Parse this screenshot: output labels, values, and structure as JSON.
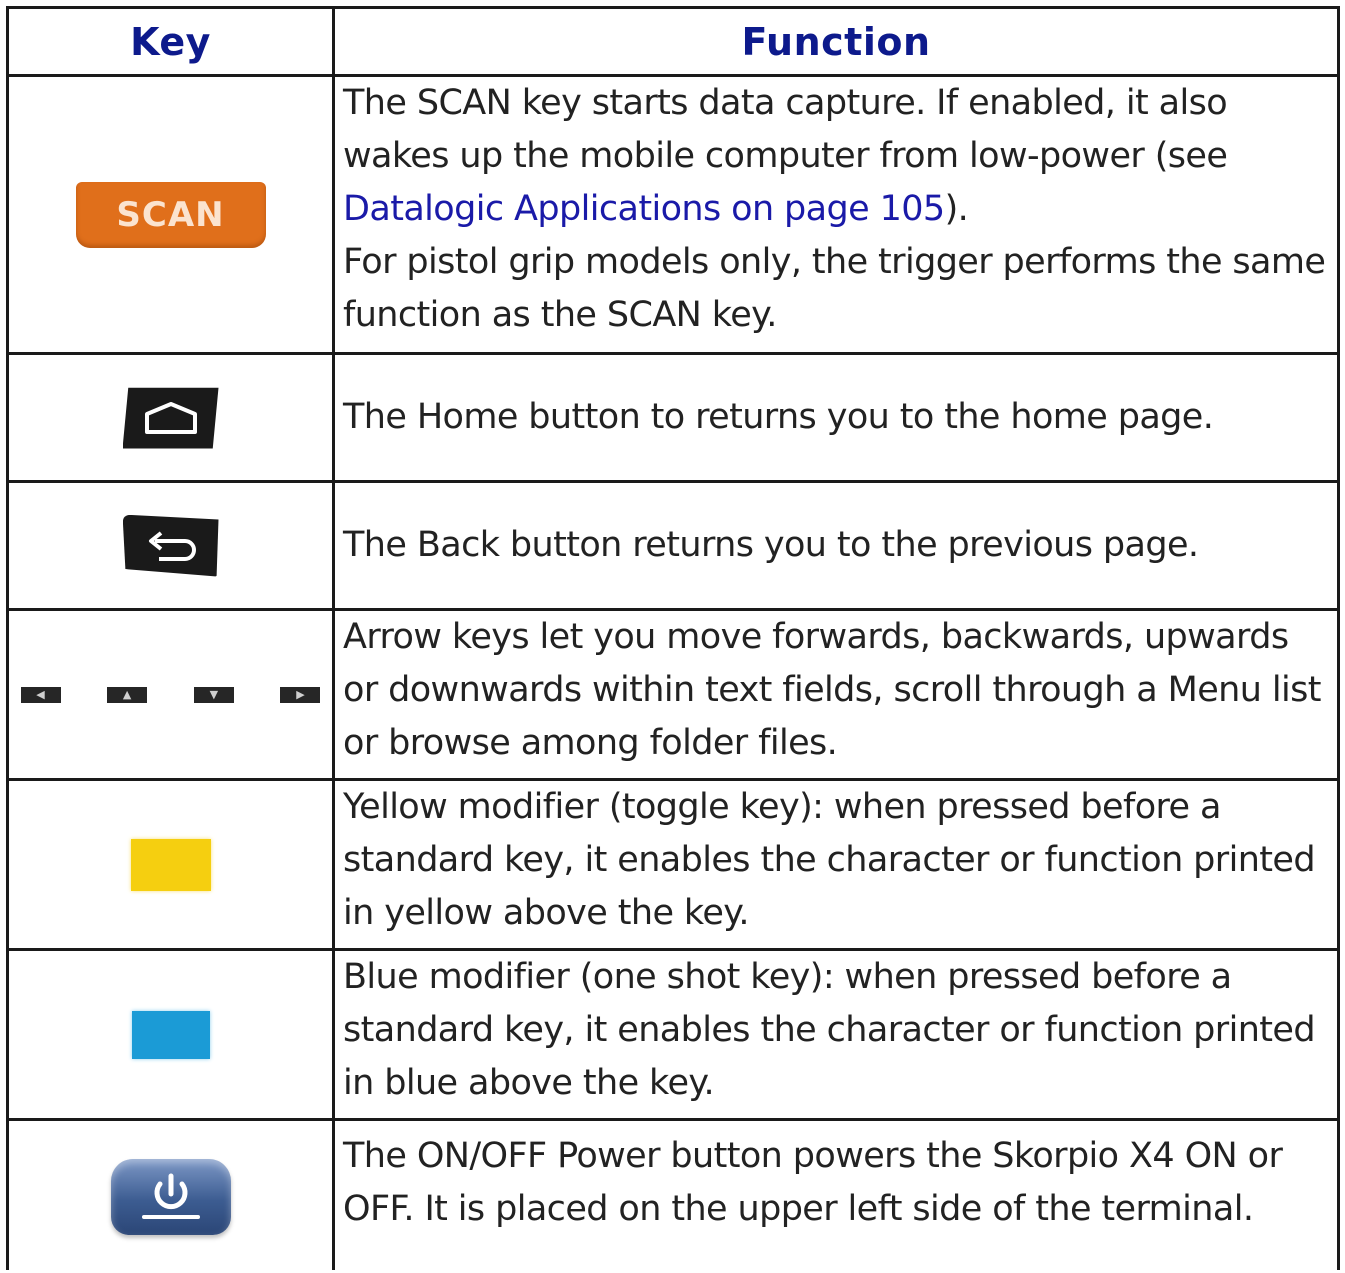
{
  "header": {
    "key": "Key",
    "function": "Function"
  },
  "rows": [
    {
      "key_label": "SCAN",
      "icon": "scan-key",
      "function_parts": {
        "p1_before": "The SCAN key starts data capture. If enabled, it also wakes up the mobile computer from low-power (see ",
        "p1_link": "Datalogic Applications on page 105",
        "p1_after": ").",
        "p2": "For pistol grip models only, the trigger performs the same function as the SCAN key."
      }
    },
    {
      "icon": "home-key",
      "function": "The Home button to returns you to the home page."
    },
    {
      "icon": "back-key",
      "function": "The Back button returns you to the previous page."
    },
    {
      "icon": "arrow-keys",
      "function": "Arrow keys let you move forwards, backwards, upwards or downwards within text fields, scroll through a Menu list or browse among folder files."
    },
    {
      "icon": "yellow-modifier-key",
      "color": "#f5cf10",
      "function": "Yellow modifier (toggle key): when pressed before a standard key, it enables the character or function printed in yellow above the key."
    },
    {
      "icon": "blue-modifier-key",
      "color": "#1b9bd6",
      "function": "Blue modifier (one shot key): when pressed before a standard key, it enables the character or function printed in blue above the key."
    },
    {
      "icon": "power-key",
      "function": "The ON/OFF Power button powers the Skorpio X4 ON or OFF. It is placed on the upper left side of the terminal."
    }
  ]
}
